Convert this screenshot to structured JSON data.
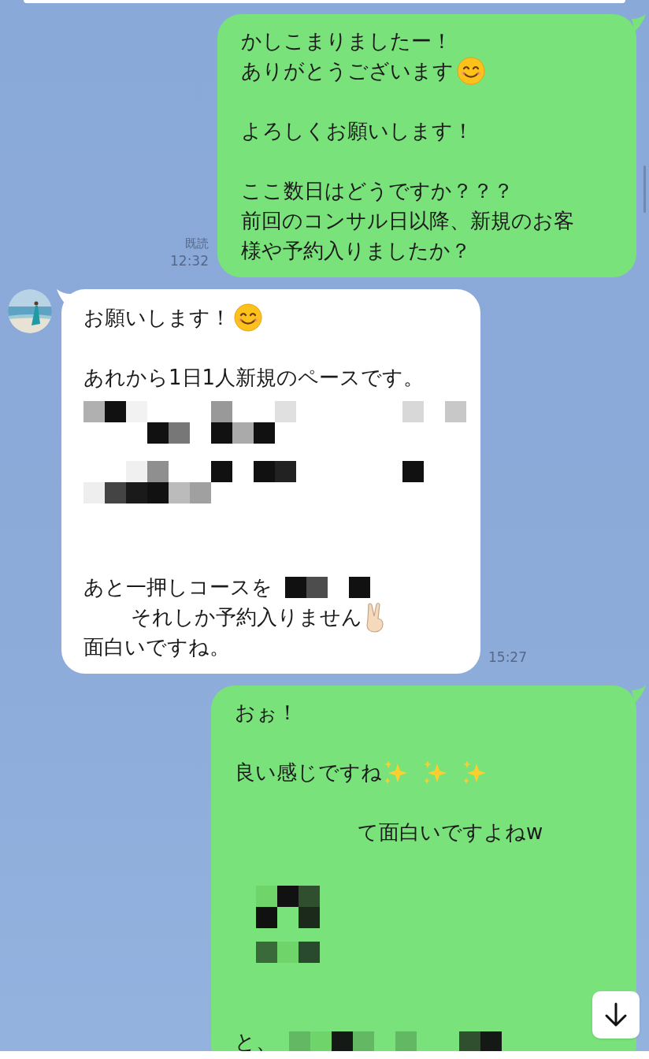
{
  "messages": [
    {
      "kind": "outgoing",
      "read": "既読",
      "time": "12:32",
      "lines": [
        {
          "kind": "text",
          "segments": [
            {
              "kind": "text",
              "text": "かしこまりましたー！"
            }
          ]
        },
        {
          "kind": "text",
          "segments": [
            {
              "kind": "text",
              "text": "ありがとうございます"
            },
            {
              "kind": "smile"
            }
          ]
        },
        {
          "kind": "blank"
        },
        {
          "kind": "text",
          "segments": [
            {
              "kind": "text",
              "text": "よろしくお願いします！"
            }
          ]
        },
        {
          "kind": "blank"
        },
        {
          "kind": "text",
          "segments": [
            {
              "kind": "text",
              "text": "ここ数日はどうですか？？？"
            }
          ]
        },
        {
          "kind": "text",
          "segments": [
            {
              "kind": "text",
              "text": "前回のコンサル日以降、新規のお客"
            }
          ]
        },
        {
          "kind": "text",
          "segments": [
            {
              "kind": "text",
              "text": "様や予約入りましたか？"
            }
          ]
        }
      ]
    },
    {
      "kind": "incoming",
      "time": "15:27",
      "lines": [
        {
          "kind": "text",
          "segments": [
            {
              "kind": "text",
              "text": "お願いします！"
            },
            {
              "kind": "smile"
            }
          ]
        },
        {
          "kind": "blank"
        },
        {
          "kind": "text",
          "segments": [
            {
              "kind": "text",
              "text": "あれから1日1人新規のペースです。"
            }
          ]
        },
        {
          "kind": "mosaic"
        },
        {
          "kind": "mosaic"
        },
        {
          "kind": "blank"
        },
        {
          "kind": "blank"
        },
        {
          "kind": "text",
          "segments": [
            {
              "kind": "text",
              "text": "あと一押しコースを"
            },
            {
              "kind": "mosaic"
            }
          ]
        },
        {
          "kind": "text",
          "segments": [
            {
              "kind": "gap"
            },
            {
              "kind": "text",
              "text": "それしか予約入りません"
            },
            {
              "kind": "peace"
            }
          ]
        },
        {
          "kind": "text",
          "segments": [
            {
              "kind": "text",
              "text": "面白いですね。"
            }
          ]
        }
      ]
    },
    {
      "kind": "outgoing",
      "lines": [
        {
          "kind": "text",
          "segments": [
            {
              "kind": "text",
              "text": "おぉ！"
            }
          ]
        },
        {
          "kind": "blank"
        },
        {
          "kind": "text",
          "segments": [
            {
              "kind": "text",
              "text": "良い感じですね"
            },
            {
              "kind": "sparkle"
            },
            {
              "kind": "sparkle"
            },
            {
              "kind": "sparkle"
            }
          ]
        },
        {
          "kind": "blank"
        },
        {
          "kind": "text",
          "segments": [
            {
              "kind": "wide-gap"
            },
            {
              "kind": "text",
              "text": "て面白いですよねw"
            }
          ]
        },
        {
          "kind": "blank"
        },
        {
          "kind": "mosaic"
        },
        {
          "kind": "mosaic"
        },
        {
          "kind": "blank"
        },
        {
          "kind": "blank"
        },
        {
          "kind": "text",
          "segments": [
            {
              "kind": "text",
              "text": "と、"
            },
            {
              "kind": "mosaic"
            }
          ]
        }
      ]
    }
  ]
}
